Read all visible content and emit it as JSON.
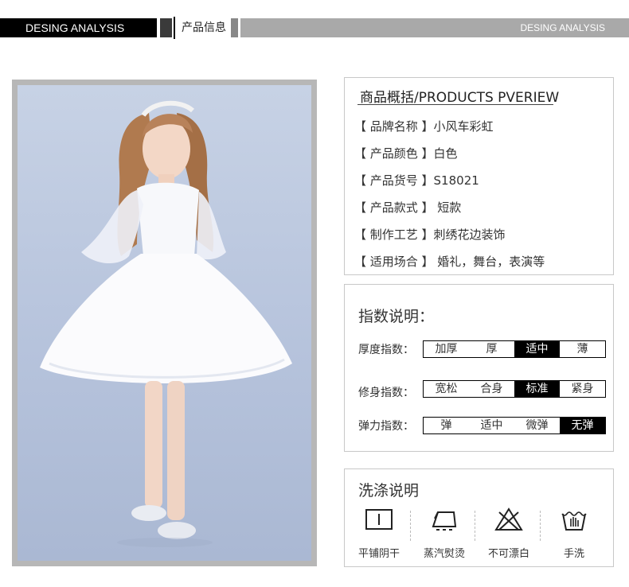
{
  "banner": {
    "left_text": "DESING ANALYSIS",
    "center_text": "产品信息",
    "right_text": "DESING ANALYSIS"
  },
  "overview": {
    "title": "商品概括/PRODUCTS PVERIEW",
    "rows": [
      "【 品牌名称 】小风车彩虹",
      "【 产品颜色 】白色",
      "【 产品货号 】S18021",
      "【 产品款式 】 短款",
      "【 制作工艺 】刺绣花边装饰",
      "【 适用场合 】 婚礼，舞台，表演等"
    ]
  },
  "index": {
    "title": "指数说明：",
    "thickness": {
      "label": "厚度指数：",
      "options": [
        "加厚",
        "厚",
        "适中",
        "薄"
      ],
      "selected": "适中"
    },
    "fit": {
      "label": "修身指数：",
      "options": [
        "宽松",
        "合身",
        "标准",
        "紧身"
      ],
      "selected": "标准"
    },
    "elastic": {
      "label": "弹力指数：",
      "options": [
        "弹",
        "适中",
        "微弹",
        "无弹"
      ],
      "selected": "无弹"
    }
  },
  "wash": {
    "title": "洗涤说明",
    "items": [
      {
        "icon": "flat-dry-shade-icon",
        "label": "平铺阴干"
      },
      {
        "icon": "steam-iron-icon",
        "label": "蒸汽熨烫"
      },
      {
        "icon": "no-bleach-icon",
        "label": "不可漂白"
      },
      {
        "icon": "hand-wash-icon",
        "label": "手洗"
      }
    ]
  },
  "colors": {
    "banner_dark": "#000000",
    "banner_grey": "#a9a9a9",
    "panel_border": "#c8c8c8",
    "selected_bg": "#000000"
  }
}
